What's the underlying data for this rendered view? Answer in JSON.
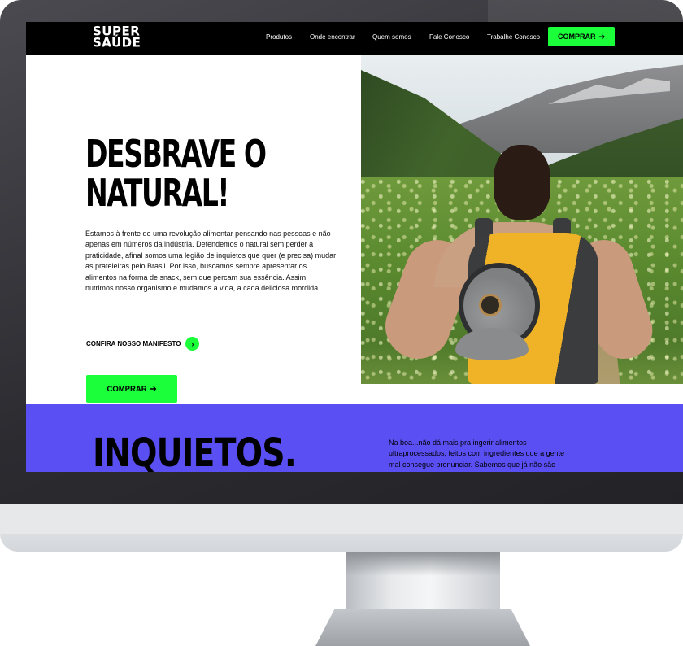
{
  "site": {
    "logo_line1": "SUPER",
    "logo_line2": "SAÚDE"
  },
  "nav": {
    "links": [
      "Produtos",
      "Onde encontrar",
      "Quem somos",
      "Fale Conosco",
      "Trabalhe Conosco"
    ],
    "buy_label": "COMPRAR",
    "buy_icon": "arrow-right-icon"
  },
  "hero": {
    "headline_line1": "DESBRAVE O",
    "headline_line2": "NATURAL!",
    "body": "Estamos à frente de uma revolução alimentar pensando nas pessoas e não apenas em números da indústria. Defendemos o natural sem perder a praticidade, afinal somos uma legião de inquietos que quer (e precisa) mudar as prateleiras pelo Brasil. Por isso, buscamos sempre apresentar os alimentos na forma de snack, sem que percam sua essência. Assim, nutrimos nosso organismo e mudamos a vida, a cada deliciosa mordida.",
    "manifesto_label": "CONFIRA NOSSO MANIFESTO",
    "manifesto_icon": "chevron-right-icon",
    "buy_label": "COMPRAR",
    "buy_icon": "arrow-right-icon"
  },
  "section": {
    "title": "INQUIETOS.",
    "copy": "Na boa...não dá mais pra ingerir alimentos ultraprocessados, feitos com ingredientes que a gente mal consegue pronunciar. Sabemos que já não são"
  },
  "colors": {
    "accent_green": "#1aff3a",
    "section_purple": "#5a4ff3",
    "nav_bg": "#000000"
  }
}
